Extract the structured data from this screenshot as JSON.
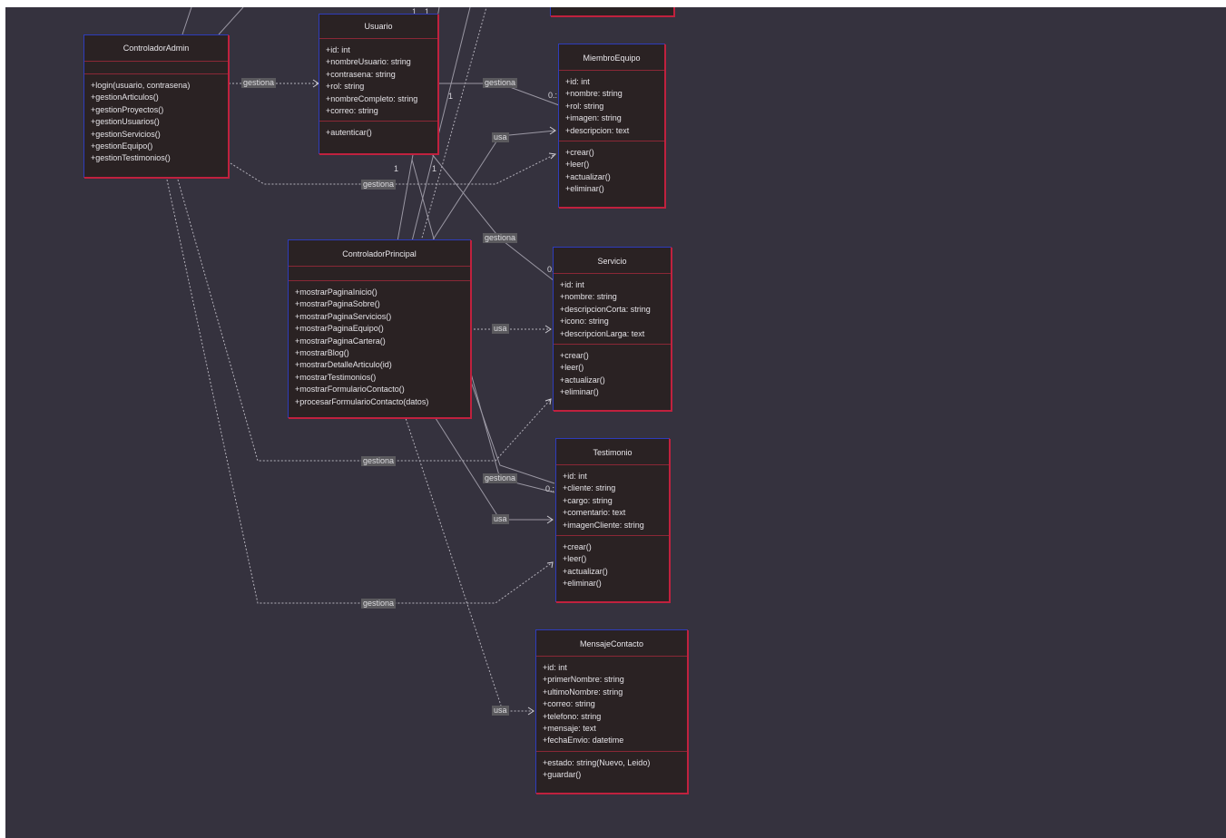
{
  "classes": {
    "usuario": {
      "name": "Usuario",
      "attributes": [
        "+id: int",
        "+nombreUsuario: string",
        "+contrasena: string",
        "+rol: string",
        "+nombreCompleto: string",
        "+correo: string"
      ],
      "methods": [
        "+autenticar()"
      ]
    },
    "admin": {
      "name": "ControladorAdmin",
      "attributes": [],
      "methods": [
        "+login(usuario, contrasena)",
        "+gestionArticulos()",
        "+gestionProyectos()",
        "+gestionUsuarios()",
        "+gestionServicios()",
        "+gestionEquipo()",
        "+gestionTestimonios()"
      ]
    },
    "miembro": {
      "name": "MiembroEquipo",
      "attributes": [
        "+id: int",
        "+nombre: string",
        "+rol: string",
        "+imagen: string",
        "+descripcion: text"
      ],
      "methods": [
        "+crear()",
        "+leer()",
        "+actualizar()",
        "+eliminar()"
      ]
    },
    "principal": {
      "name": "ControladorPrincipal",
      "attributes": [],
      "methods": [
        "+mostrarPaginaInicio()",
        "+mostrarPaginaSobre()",
        "+mostrarPaginaServicios()",
        "+mostrarPaginaEquipo()",
        "+mostrarPaginaCartera()",
        "+mostrarBlog()",
        "+mostrarDetalleArticulo(id)",
        "+mostrarTestimonios()",
        "+mostrarFormularioContacto()",
        "+procesarFormularioContacto(datos)"
      ]
    },
    "servicio": {
      "name": "Servicio",
      "attributes": [
        "+id: int",
        "+nombre: string",
        "+descripcionCorta: string",
        "+icono: string",
        "+descripcionLarga: text"
      ],
      "methods": [
        "+crear()",
        "+leer()",
        "+actualizar()",
        "+eliminar()"
      ]
    },
    "testimonio": {
      "name": "Testimonio",
      "attributes": [
        "+id: int",
        "+cliente: string",
        "+cargo: string",
        "+comentario: text",
        "+imagenCliente: string"
      ],
      "methods": [
        "+crear()",
        "+leer()",
        "+actualizar()",
        "+eliminar()"
      ]
    },
    "mensaje": {
      "name": "MensajeContacto",
      "attributes": [
        "+id: int",
        "+primerNombre: string",
        "+ultimoNombre: string",
        "+correo: string",
        "+telefono: string",
        "+mensaje: text",
        "+fechaEnvio: datetime"
      ],
      "methods": [
        "+estado: string(Nuevo, Leido)",
        "+guardar()"
      ]
    }
  },
  "edge_labels": {
    "gestiona": "gestiona",
    "usa": "usa"
  },
  "multiplicities": {
    "one": "1",
    "many": "0..*",
    "many_short": "0.:"
  },
  "colors": {
    "background": "#35323e",
    "class_fill": "#2a2223",
    "border_blue": "#2e3cbb",
    "border_red": "#c0213e",
    "edge_line": "#9a97a3"
  }
}
